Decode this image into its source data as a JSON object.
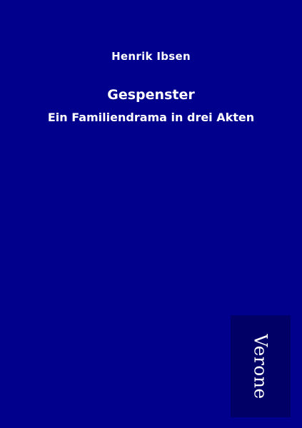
{
  "cover": {
    "author": "Henrik Ibsen",
    "title": "Gespenster",
    "subtitle": "Ein Familiendrama in drei Akten",
    "publisher": "Verone"
  },
  "colors": {
    "background": "#00008c",
    "publisher_box": "#000066",
    "text": "#ffffff"
  }
}
